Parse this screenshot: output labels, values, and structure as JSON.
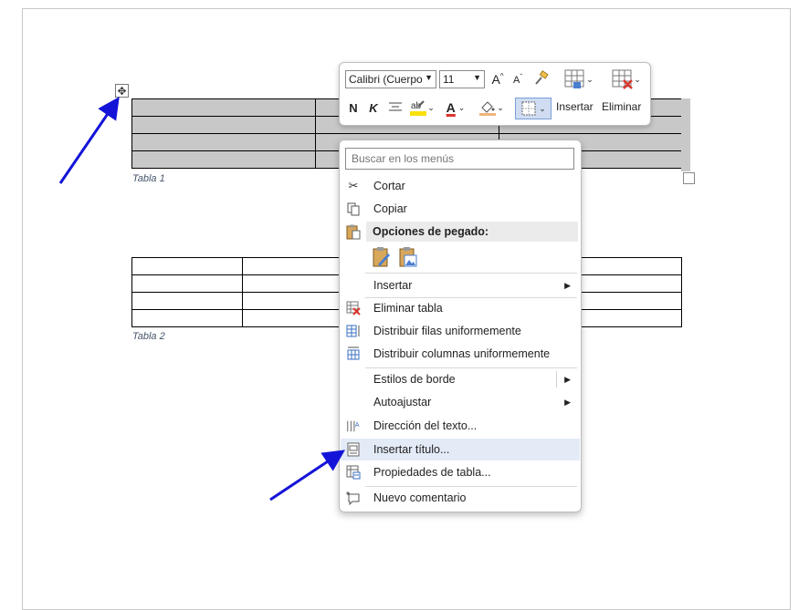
{
  "toolbar": {
    "font_name": "Calibri (Cuerpo",
    "font_size": "11",
    "grow_font": "A",
    "shrink_font": "A",
    "bold": "N",
    "italic": "K",
    "font_color": "A",
    "insert_label": "Insertar",
    "delete_label": "Eliminar"
  },
  "captions": {
    "table1": "Tabla 1",
    "table2": "Tabla 2"
  },
  "menu": {
    "search_placeholder": "Buscar en los menús",
    "paste_header": "Opciones de pegado:",
    "items": [
      {
        "label": "Cortar",
        "icon": "scissors-icon"
      },
      {
        "label": "Copiar",
        "icon": "copy-icon"
      },
      {
        "label": "Insertar",
        "icon": "",
        "submenu": true
      },
      {
        "label": "Eliminar tabla",
        "icon": "delete-table-icon"
      },
      {
        "label": "Distribuir filas uniformemente",
        "icon": "distribute-rows-icon"
      },
      {
        "label": "Distribuir columnas uniformemente",
        "icon": "distribute-columns-icon"
      },
      {
        "label": "Estilos de borde",
        "icon": "",
        "submenu": true
      },
      {
        "label": "Autoajustar",
        "icon": "",
        "submenu": true
      },
      {
        "label": "Dirección del texto...",
        "icon": "text-direction-icon"
      },
      {
        "label": "Insertar título...",
        "icon": "insert-caption-icon",
        "highlighted": true
      },
      {
        "label": "Propiedades de tabla...",
        "icon": "table-properties-icon"
      },
      {
        "label": "Nuevo comentario",
        "icon": "new-comment-icon"
      }
    ]
  },
  "colors": {
    "arrow": "#1414d8",
    "highlight": "#e3ebf7",
    "table_selection": "#c8c8c8"
  }
}
